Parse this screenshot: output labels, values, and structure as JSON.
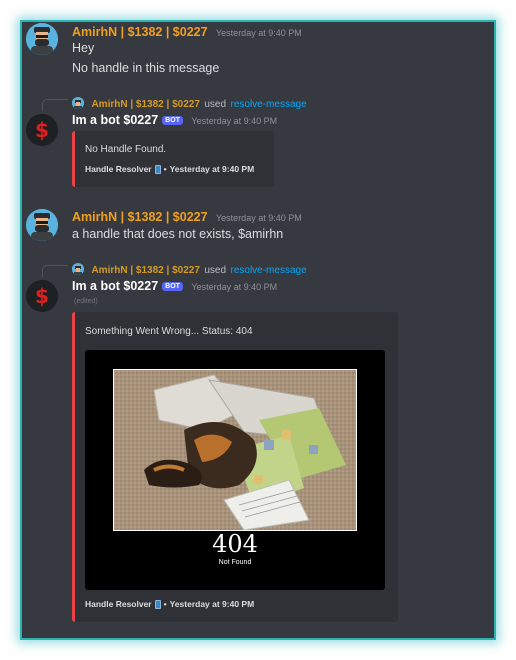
{
  "messages": [
    {
      "author": "AmirhN | $1382 | $0227",
      "timestamp": "Yesterday at 9:40 PM",
      "lines": [
        "Hey",
        "No handle in this message"
      ]
    },
    {
      "reply": {
        "author": "AmirhN | $1382 | $0227",
        "used": "used",
        "command": "resolve-message"
      },
      "author": "Im a bot $0227",
      "bot_tag": "BOT",
      "timestamp": "Yesterday at 9:40 PM",
      "embed": {
        "description": "No Handle Found.",
        "footer_text": "Handle Resolver",
        "footer_sep": "•",
        "footer_time": "Yesterday at 9:40 PM"
      }
    },
    {
      "author": "AmirhN | $1382 | $0227",
      "timestamp": "Yesterday at 9:40 PM",
      "lines": [
        "a handle that does not exists, $amirhn"
      ]
    },
    {
      "reply": {
        "author": "AmirhN | $1382 | $0227",
        "used": "used",
        "command": "resolve-message"
      },
      "author": "Im a bot $0227",
      "bot_tag": "BOT",
      "timestamp": "Yesterday at 9:40 PM",
      "edited": "(edited)",
      "embed": {
        "description": "Something Went Wrong... Status: 404",
        "image": {
          "big_text": "404",
          "small_text": "Not Found"
        },
        "footer_text": "Handle Resolver",
        "footer_sep": "•",
        "footer_time": "Yesterday at 9:40 PM"
      }
    }
  ],
  "colors": {
    "background": "#36393f",
    "user_name": "#f0a020",
    "command_link": "#00a8fc",
    "embed_bar": "#ed4245",
    "bot_tag": "#5865f2",
    "frame_glow": "#2bb3b0"
  },
  "icons": {
    "user_avatar": "bearded-man-avatar-icon",
    "bot_avatar": "dollar-sign-avatar-icon",
    "footer_icon": "mobile-phone-icon"
  }
}
